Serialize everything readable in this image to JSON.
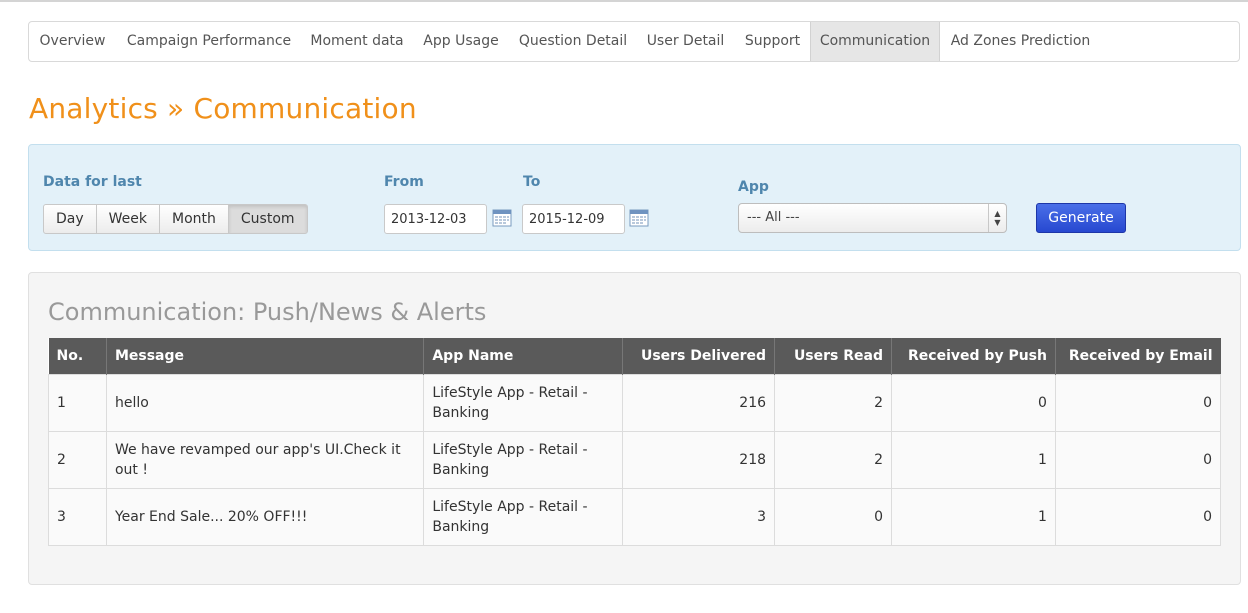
{
  "tabs": [
    {
      "label": "Overview"
    },
    {
      "label": "Campaign Performance"
    },
    {
      "label": "Moment data"
    },
    {
      "label": "App Usage"
    },
    {
      "label": "Question Detail"
    },
    {
      "label": "User Detail"
    },
    {
      "label": "Support"
    },
    {
      "label": "Communication",
      "active": true
    },
    {
      "label": "Ad Zones Prediction"
    }
  ],
  "page_title": "Analytics » Communication",
  "filters": {
    "data_for_last_label": "Data for last",
    "periods": [
      "Day",
      "Week",
      "Month",
      "Custom"
    ],
    "selected_period": "Custom",
    "from_label": "From",
    "from_value": "2013-12-03",
    "to_label": "To",
    "to_value": "2015-12-09",
    "app_label": "App",
    "app_selected": "--- All ---",
    "generate_label": "Generate"
  },
  "results": {
    "title": "Communication: Push/News & Alerts",
    "columns": [
      "No.",
      "Message",
      "App Name",
      "Users Delivered",
      "Users Read",
      "Received by Push",
      "Received by Email"
    ],
    "rows": [
      [
        "1",
        "hello",
        "LifeStyle App - Retail - Banking",
        "216",
        "2",
        "0",
        "0"
      ],
      [
        "2",
        "We have revamped our app's UI.Check it out !",
        "LifeStyle App - Retail - Banking",
        "218",
        "2",
        "1",
        "0"
      ],
      [
        "3",
        "Year End Sale... 20% OFF!!!",
        "LifeStyle App - Retail - Banking",
        "3",
        "0",
        "1",
        "0"
      ]
    ]
  },
  "colors": {
    "title_orange": "#f0901a",
    "filter_bg": "#e3f1f9",
    "label_blue": "#4f86ad",
    "header_gray": "#5a5a5a",
    "generate_blue": "#2748d0"
  },
  "icons": {
    "calendar": "calendar-icon",
    "select_arrows": "select-arrows-icon"
  }
}
